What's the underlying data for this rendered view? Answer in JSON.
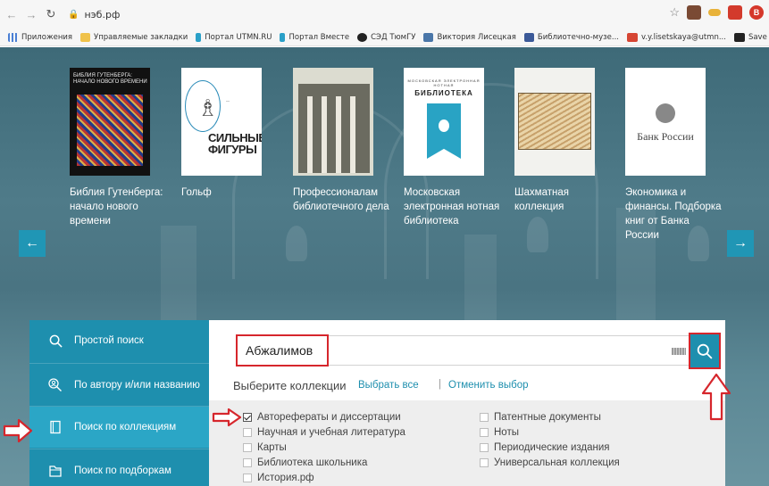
{
  "browser": {
    "url": "нэб.рф",
    "avatar_letter": "B"
  },
  "bookmarks": [
    {
      "label": "Приложения",
      "icon": "apps-grid-icon"
    },
    {
      "label": "Управляемые закладки",
      "icon": "folder-icon"
    },
    {
      "label": "Портал UTMN.RU",
      "icon": "utmn-flag-icon"
    },
    {
      "label": "Портал Вместе",
      "icon": "utmn-flag-icon"
    },
    {
      "label": "СЭД ТюмГУ",
      "icon": "bird-icon"
    },
    {
      "label": "Виктория Лисецкая",
      "icon": "vk-icon"
    },
    {
      "label": "Библиотечно-музе...",
      "icon": "facebook-icon"
    },
    {
      "label": "v.y.lisetskaya@utmn...",
      "icon": "gmail-icon"
    },
    {
      "label": "Save to Mendeley",
      "icon": "mendeley-icon"
    }
  ],
  "carousel": {
    "items": [
      {
        "title": "Библия Гутенберга: начало нового времени",
        "cover_text": "БИБЛИЯ ГУТЕНБЕРГА: НАЧАЛО НОВОГО ВРЕМЕНИ"
      },
      {
        "title": "Гольф",
        "cover_text": "СИЛЬНЫЕ ФИГУРЫ"
      },
      {
        "title": "Профессионалам библиотечного дела",
        "cover_text": ""
      },
      {
        "title": "Московская электронная нотная библиотека",
        "cover_text": "БИБЛИОТЕКА",
        "cover_head": "МОСКОВСКАЯ ЭЛЕКТРОННАЯ НОТНАЯ"
      },
      {
        "title": "Шахматная коллекция",
        "cover_text": ""
      },
      {
        "title": "Экономика и финансы. Подборка книг от Банка России",
        "cover_text": "Банк России"
      }
    ]
  },
  "sidebar": {
    "items": [
      {
        "label": "Простой поиск",
        "icon": "search-icon"
      },
      {
        "label": "По автору и/или названию",
        "icon": "author-search-icon"
      },
      {
        "label": "Поиск по коллекциям",
        "icon": "collection-icon",
        "active": true
      },
      {
        "label": "Поиск по подборкам",
        "icon": "selection-icon"
      }
    ]
  },
  "search": {
    "value": "Абжалимов"
  },
  "collections": {
    "title": "Выберите коллекции",
    "select_all": "Выбрать все",
    "separator": "|",
    "cancel": "Отменить выбор",
    "left": [
      {
        "label": "Авторефераты и диссертации",
        "checked": true
      },
      {
        "label": "Научная и учебная литература",
        "checked": false
      },
      {
        "label": "Карты",
        "checked": false
      },
      {
        "label": "Библиотека школьника",
        "checked": false
      },
      {
        "label": "История.рф",
        "checked": false
      }
    ],
    "right": [
      {
        "label": "Патентные документы",
        "checked": false
      },
      {
        "label": "Ноты",
        "checked": false
      },
      {
        "label": "Периодические издания",
        "checked": false
      },
      {
        "label": "Универсальная коллекция",
        "checked": false
      }
    ]
  },
  "colors": {
    "accent": "#1e8fae",
    "accent_active": "#2ba6c6",
    "annotation": "#d6262c"
  }
}
